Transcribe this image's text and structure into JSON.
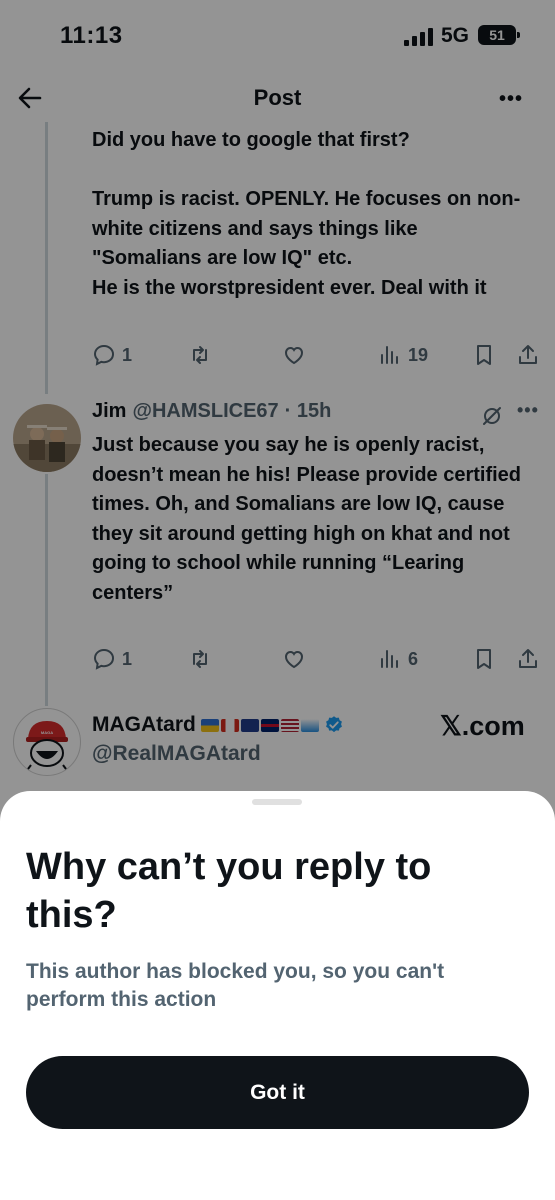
{
  "status_bar": {
    "time": "11:13",
    "network": "5G",
    "battery": "51"
  },
  "header": {
    "title": "Post",
    "more": "•••"
  },
  "post1": {
    "text": "Did you have to google that first?\n\nTrump is racist.  OPENLY. He focuses on non-white citizens and says things like \"Somalians are low IQ\" etc.\nHe is the worstpresident ever. Deal with it",
    "replies": "1",
    "views": "19"
  },
  "post2": {
    "name": "Jim",
    "handle": "@HAMSLICE67",
    "time": "· 15h",
    "more": "•••",
    "text": "Just because you say he is openly racist, doesn’t mean he his! Please provide certified times. Oh, and Somalians are low IQ, cause they sit around getting high on khat and not going to school while running “Learing centers”",
    "replies": "1",
    "views": "6"
  },
  "post3": {
    "name": "MAGAtard",
    "handle": "@RealMAGAtard",
    "watermark": "𝕏.com",
    "avatar_hat_text": "MAKE AMERICA GREAT AGAIN"
  },
  "sheet": {
    "title": "Why can’t you reply to this?",
    "body": "This author has blocked you, so you can't perform this action",
    "button_label": "Got it"
  },
  "colors": {
    "text": "#0f1419",
    "secondary": "#536471",
    "verified": "#1d9bf0",
    "line": "#cfd9de"
  }
}
